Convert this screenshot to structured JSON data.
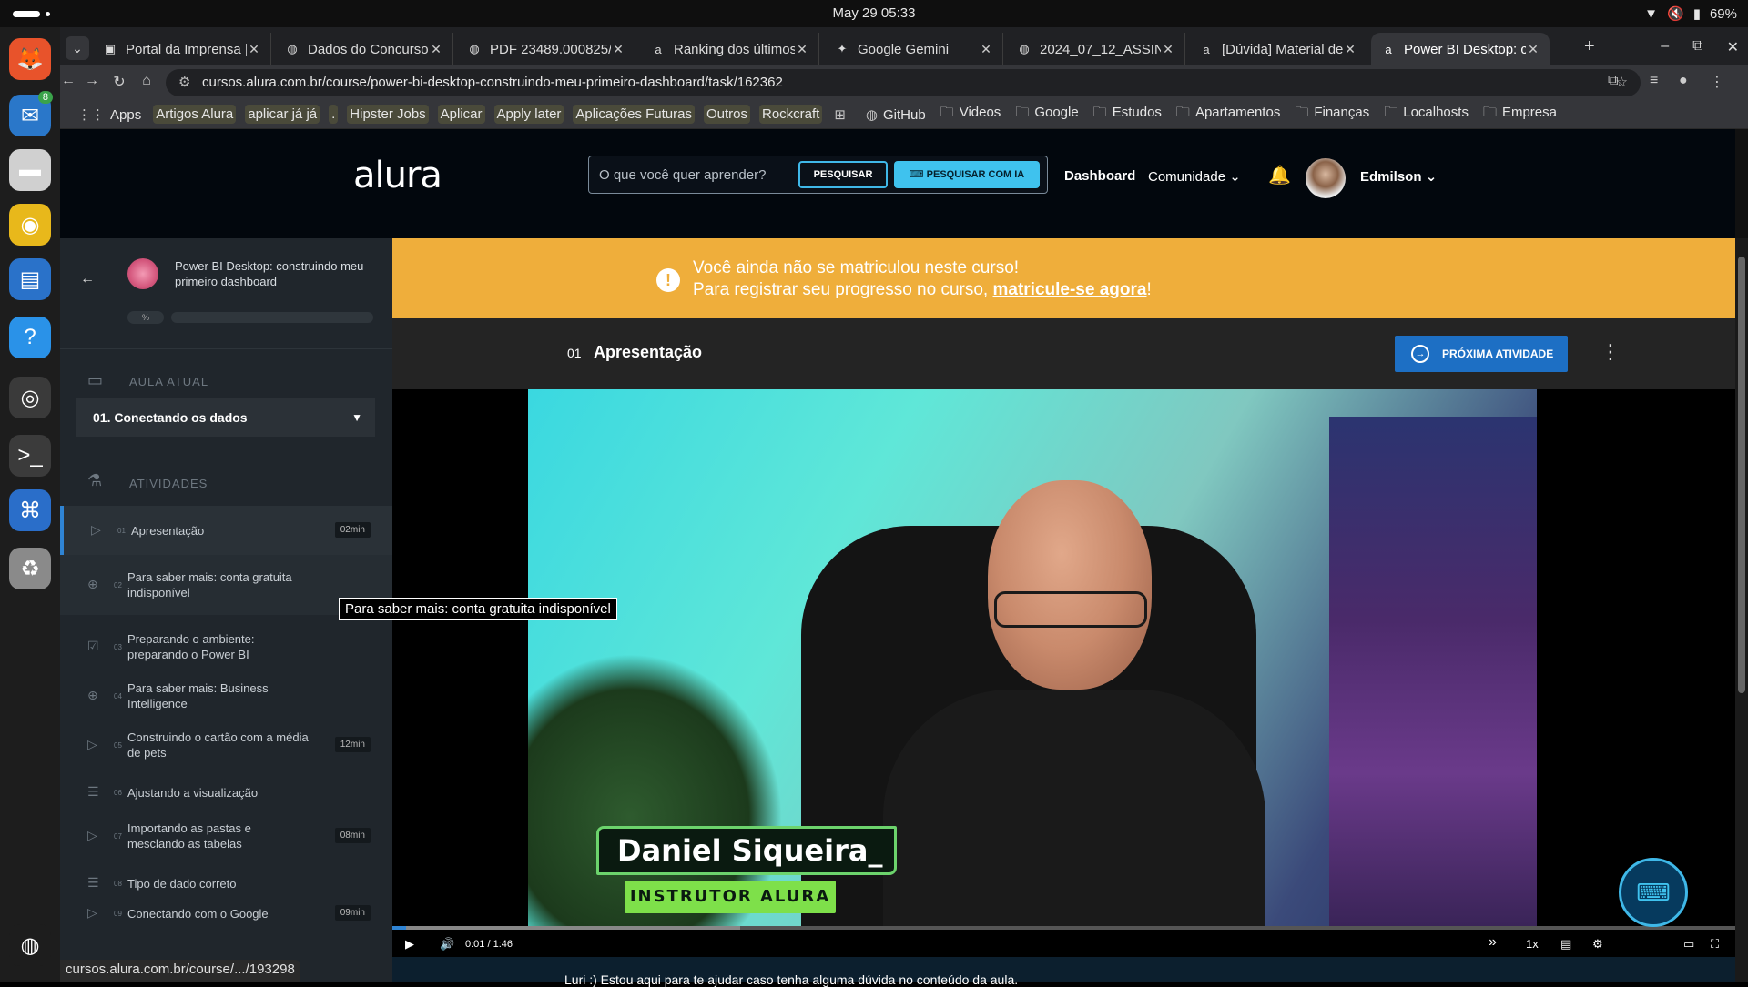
{
  "system": {
    "clock": "May 29  05:33",
    "battery": "69%"
  },
  "dock": {
    "apps": [
      {
        "name": "firefox-icon",
        "glyph": "🦊",
        "bg": "#e8532b"
      },
      {
        "name": "thunderbird-icon",
        "glyph": "✉",
        "bg": "#2a77c9",
        "badge": "8"
      },
      {
        "name": "files-icon",
        "glyph": "▬",
        "bg": "#d0d0d0"
      },
      {
        "name": "rhythmbox-icon",
        "glyph": "◉",
        "bg": "#e8b81b"
      },
      {
        "name": "writer-icon",
        "glyph": "▤",
        "bg": "#2a72c9"
      },
      {
        "name": "help-icon",
        "glyph": "?",
        "bg": "#2a92e8"
      },
      {
        "name": "chrome-icon",
        "glyph": "◎",
        "bg": "#3a3a3a"
      },
      {
        "name": "terminal-icon",
        "glyph": ">_",
        "bg": "#3b3b3b"
      },
      {
        "name": "vscode-icon",
        "glyph": "⌘",
        "bg": "#2a6ec9"
      },
      {
        "name": "trash-icon",
        "glyph": "♻",
        "bg": "#8a8a8a"
      },
      {
        "name": "ubuntu-icon",
        "glyph": "◍",
        "bg": "#1d1d1d"
      }
    ]
  },
  "tabs": [
    {
      "title": "Portal da Imprensa |",
      "fav": "▣"
    },
    {
      "title": "Dados do Concurso",
      "fav": "◍"
    },
    {
      "title": "PDF 23489.000825/",
      "fav": "◍"
    },
    {
      "title": "Ranking dos últimos",
      "fav": "a"
    },
    {
      "title": "Google Gemini",
      "fav": "✦"
    },
    {
      "title": "2024_07_12_ASSIN",
      "fav": "◍"
    },
    {
      "title": "[Dúvida] Material de",
      "fav": "a"
    },
    {
      "title": "Power BI Desktop: c",
      "fav": "a"
    }
  ],
  "omnibox": {
    "url": "cursos.alura.com.br/course/power-bi-desktop-construindo-meu-primeiro-dashboard/task/162362"
  },
  "bookmarks": [
    {
      "label": "Apps",
      "ico": "⋮⋮",
      "hl": false
    },
    {
      "label": "Artigos Alura",
      "ico": "",
      "hl": true
    },
    {
      "label": "aplicar já já",
      "ico": "",
      "hl": true
    },
    {
      "label": ".",
      "ico": "",
      "hl": true
    },
    {
      "label": "Hipster Jobs",
      "ico": "",
      "hl": true
    },
    {
      "label": "Aplicar",
      "ico": "",
      "hl": true
    },
    {
      "label": "Apply later",
      "ico": "",
      "hl": true
    },
    {
      "label": "Aplicações Futuras",
      "ico": "",
      "hl": true
    },
    {
      "label": "Outros",
      "ico": "",
      "hl": true
    },
    {
      "label": "Rockcraft",
      "ico": "",
      "hl": true
    },
    {
      "label": "",
      "ico": "⊞",
      "hl": false
    },
    {
      "label": "GitHub",
      "ico": "◍",
      "hl": false
    },
    {
      "label": "Videos",
      "ico": "🗀",
      "hl": false
    },
    {
      "label": "Google",
      "ico": "🗀",
      "hl": false
    },
    {
      "label": "Estudos",
      "ico": "🗀",
      "hl": false
    },
    {
      "label": "Apartamentos",
      "ico": "🗀",
      "hl": false
    },
    {
      "label": "Finanças",
      "ico": "🗀",
      "hl": false
    },
    {
      "label": "Localhosts",
      "ico": "🗀",
      "hl": false
    },
    {
      "label": "Empresa",
      "ico": "🗀",
      "hl": false
    }
  ],
  "header": {
    "logo": "alura",
    "search_placeholder": "O que você quer aprender?",
    "search_button": "PESQUISAR",
    "ai_search_button": "PESQUISAR COM IA",
    "dashboard": "Dashboard",
    "community": "Comunidade",
    "user": "Edmilson"
  },
  "sidebar": {
    "course_title": "Power BI Desktop: construindo meu primeiro dashboard",
    "percent": "%",
    "current_label": "AULA ATUAL",
    "current_lesson": "01. Conectando os dados",
    "activities_label": "ATIVIDADES",
    "activities": [
      {
        "num": "01",
        "label": "Apresentação",
        "dur": "02min",
        "icon": "▷"
      },
      {
        "num": "02",
        "label": "Para saber mais: conta gratuita indisponível",
        "dur": "",
        "icon": "⊕"
      },
      {
        "num": "03",
        "label": "Preparando o ambiente: preparando o Power BI",
        "dur": "",
        "icon": "☑"
      },
      {
        "num": "04",
        "label": "Para saber mais: Business Intelligence",
        "dur": "",
        "icon": "⊕"
      },
      {
        "num": "05",
        "label": "Construindo o cartão com a média de pets",
        "dur": "12min",
        "icon": "▷"
      },
      {
        "num": "06",
        "label": "Ajustando a visualização",
        "dur": "",
        "icon": "☰"
      },
      {
        "num": "07",
        "label": "Importando as pastas e mesclando as tabelas",
        "dur": "08min",
        "icon": "▷"
      },
      {
        "num": "08",
        "label": "Tipo de dado correto",
        "dur": "",
        "icon": "☰"
      },
      {
        "num": "09",
        "label": "Conectando com o Google",
        "dur": "09min",
        "icon": "▷"
      }
    ]
  },
  "banner": {
    "line1": "Você ainda não se matriculou neste curso!",
    "line2_prefix": "Para registrar seu progresso no curso, ",
    "line2_link": "matricule-se agora",
    "line2_suffix": "!"
  },
  "lesson": {
    "num": "01",
    "title": "Apresentação",
    "next_button": "PRÓXIMA ATIVIDADE"
  },
  "video": {
    "name_tag": "Daniel Siqueira_",
    "role_tag": "INSTRUTOR ALURA",
    "current_time": "0:01",
    "separator": "/",
    "duration": "1:46",
    "speed": "1x",
    "progress_fraction": 0.01
  },
  "tooltip": "Para saber mais: conta gratuita indisponível",
  "caption": "Luri :) Estou aqui para te ajudar caso tenha alguma dúvida no conteúdo da aula.",
  "statusbar": "cursos.alura.com.br/course/.../193298"
}
